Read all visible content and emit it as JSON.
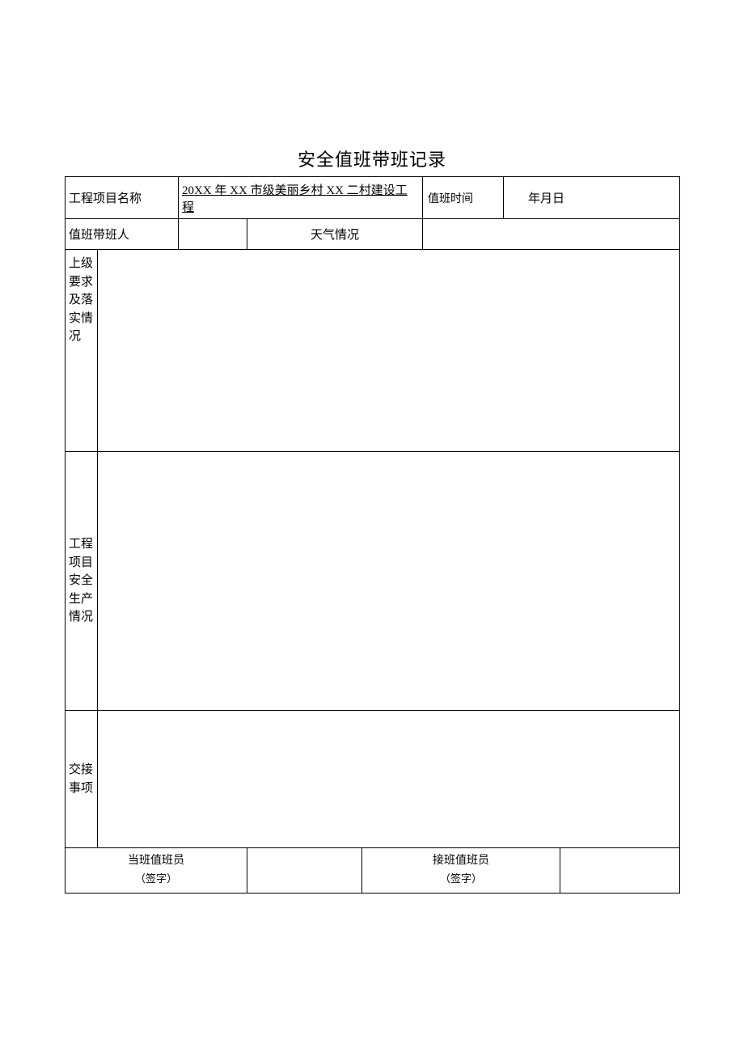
{
  "title": "安全值班带班记录",
  "row1": {
    "projectNameLabel": "工程项目名称",
    "projectNameValue": "20XX 年 XX 市级美丽乡村 XX 二村建设工程",
    "dutyTimeLabel": "值班时间",
    "dutyTimeValue": "年月日"
  },
  "row2": {
    "dutyLeaderLabel": "值班带班人",
    "weatherLabel": "天气情况",
    "weatherValue": ""
  },
  "sections": {
    "superiorReq": "上级要求及落实情况",
    "safetyProd": "工程项目安全生产情况",
    "handover": "交接事项"
  },
  "signature": {
    "currentDutyLabel": "当班值班员",
    "currentDutySub": "（签字）",
    "nextDutyLabel": "接班值班员",
    "nextDutySub": "（签字）"
  }
}
